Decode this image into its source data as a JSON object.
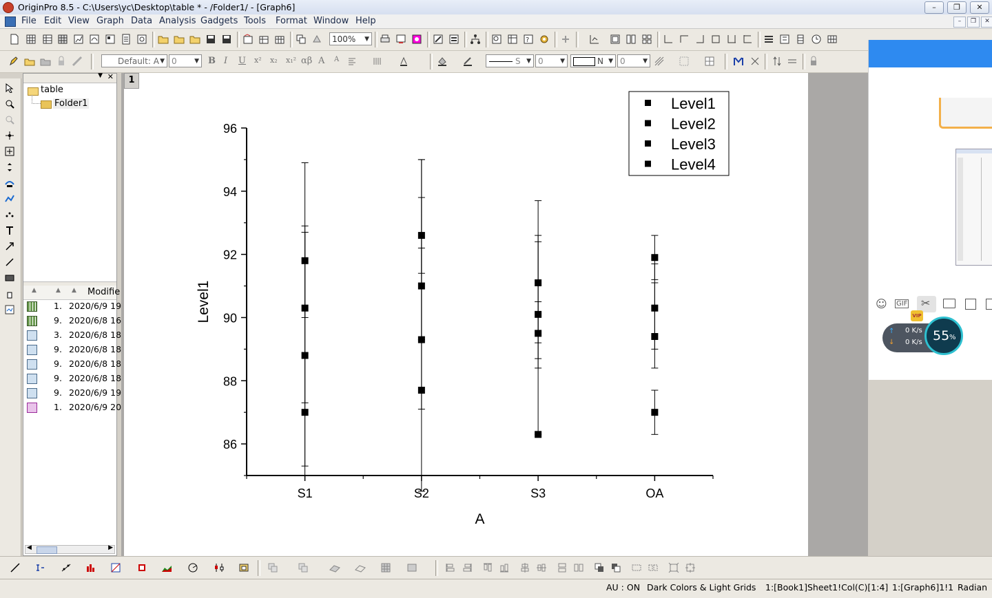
{
  "window": {
    "title": "OriginPro 8.5 - C:\\Users\\yc\\Desktop\\table * - /Folder1/ - [Graph6]"
  },
  "menu": [
    "File",
    "Edit",
    "View",
    "Graph",
    "Data",
    "Analysis",
    "Gadgets",
    "Tools",
    "Format",
    "Window",
    "Help"
  ],
  "toolbar": {
    "zoom": "100%",
    "font": "Default: A",
    "size": "0",
    "line_style": "S",
    "line_width": "0",
    "fill_pattern": "N",
    "fill_width": "0"
  },
  "explorer": {
    "root": "table",
    "folder": "Folder1",
    "column_header": "Modifie",
    "rows": [
      {
        "icon": "book",
        "n": "1.",
        "date": "2020/6/9 19"
      },
      {
        "icon": "book",
        "n": "9.",
        "date": "2020/6/8 16"
      },
      {
        "icon": "graph",
        "n": "3.",
        "date": "2020/6/8 18"
      },
      {
        "icon": "graph",
        "n": "9.",
        "date": "2020/6/8 18"
      },
      {
        "icon": "graph",
        "n": "9.",
        "date": "2020/6/8 18"
      },
      {
        "icon": "graph",
        "n": "9.",
        "date": "2020/6/8 18"
      },
      {
        "icon": "graph",
        "n": "9.",
        "date": "2020/6/9 19"
      },
      {
        "icon": "graph6",
        "n": "1.",
        "date": "2020/6/9 20"
      }
    ]
  },
  "layer_label": "1",
  "chart_data": {
    "type": "scatter",
    "xlabel": "A",
    "ylabel": "Level1",
    "categories": [
      "S1",
      "S2",
      "S3",
      "OA"
    ],
    "ylim": [
      85,
      96
    ],
    "yticks": [
      86,
      88,
      90,
      92,
      94,
      96
    ],
    "legend_position": "top-right",
    "series": [
      {
        "name": "Level1",
        "values": [
          91.8,
          92.6,
          91.1,
          91.9
        ],
        "err_low": [
          1.8,
          1.2,
          2.4,
          0.7
        ],
        "err_high": [
          3.1,
          2.4,
          2.6,
          0.7
        ]
      },
      {
        "name": "Level2",
        "values": [
          90.3,
          91.0,
          90.1,
          90.3
        ],
        "err_low": [
          3.0,
          1.7,
          0.9,
          1.3
        ],
        "err_high": [
          2.4,
          1.2,
          0.4,
          1.4
        ]
      },
      {
        "name": "Level3",
        "values": [
          88.8,
          89.3,
          89.5,
          89.4
        ],
        "err_low": [
          3.5,
          4.8,
          1.1,
          1.0
        ],
        "err_high": [
          3.9,
          4.5,
          2.9,
          1.7
        ]
      },
      {
        "name": "Level4",
        "values": [
          87.0,
          87.7,
          86.3,
          87.0
        ],
        "err_low": [
          2.0,
          0.6,
          0.0,
          0.7
        ],
        "err_high": [
          5.9,
          7.3,
          6.3,
          0.7
        ]
      }
    ]
  },
  "status": {
    "au": "AU : ON",
    "theme": "Dark Colors & Light Grids",
    "dataset": "1:[Book1]Sheet1!Col(C)[1:4]",
    "graph": "1:[Graph6]1!1",
    "angle": "Radian"
  },
  "overlay": {
    "up_speed": "0 K/s",
    "down_speed": "0 K/s",
    "percent": "55",
    "percent_sign": "%",
    "gif_label": "GIF",
    "vip_label": "VIP"
  }
}
